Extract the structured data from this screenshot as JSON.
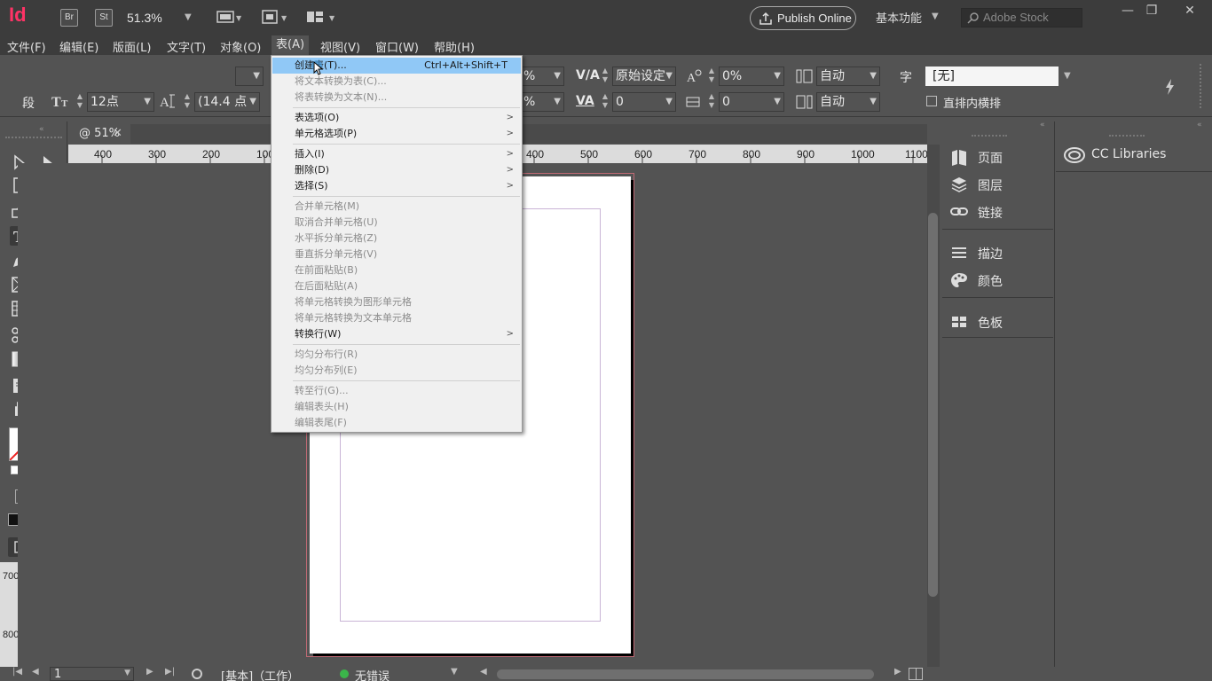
{
  "app": {
    "logo": "Id",
    "badges": [
      "Br",
      "St"
    ],
    "zoom": "51.3%",
    "publish_label": "Publish Online",
    "workspace": "基本功能",
    "stock_placeholder": "Adobe Stock"
  },
  "menubar": {
    "items": [
      "文件(F)",
      "编辑(E)",
      "版面(L)",
      "文字(T)",
      "对象(O)",
      "表(A)",
      "视图(V)",
      "窗口(W)",
      "帮助(H)"
    ],
    "active": "表(A)"
  },
  "control": {
    "paragraph_label": "段",
    "font_size": "12点",
    "leading": "(14.4 点",
    "pct1": "%",
    "pct2": "%",
    "kerning": "原始设定",
    "tracking": "0",
    "baseline_pct": "0%",
    "skew": "0",
    "auto1": "自动",
    "auto2": "自动",
    "char_label": "字",
    "char_style": "[无]",
    "tate_chu_yoko": "直排内横排"
  },
  "document": {
    "tab_label": "@ 51%"
  },
  "ruler": {
    "h_labels": [
      "400",
      "300",
      "200",
      "100",
      "400",
      "500",
      "600",
      "700",
      "800",
      "900",
      "1000",
      "1100"
    ],
    "v_labels": [
      "700",
      "800"
    ]
  },
  "dropdown": {
    "items": [
      {
        "label": "创建表(T)...",
        "shortcut": "Ctrl+Alt+Shift+T",
        "disabled": false,
        "highlight": true
      },
      {
        "label": "将文本转换为表(C)...",
        "disabled": true
      },
      {
        "label": "将表转换为文本(N)...",
        "disabled": true
      },
      {
        "label": "表选项(O)",
        "submenu": true,
        "disabled": false
      },
      {
        "label": "单元格选项(P)",
        "submenu": true,
        "disabled": false
      },
      {
        "label": "插入(I)",
        "submenu": true,
        "disabled": false
      },
      {
        "label": "删除(D)",
        "submenu": true,
        "disabled": false
      },
      {
        "label": "选择(S)",
        "submenu": true,
        "disabled": false
      },
      {
        "label": "合并单元格(M)",
        "disabled": true
      },
      {
        "label": "取消合并单元格(U)",
        "disabled": true
      },
      {
        "label": "水平拆分单元格(Z)",
        "disabled": true
      },
      {
        "label": "垂直拆分单元格(V)",
        "disabled": true
      },
      {
        "label": "在前面粘贴(B)",
        "disabled": true
      },
      {
        "label": "在后面粘贴(A)",
        "disabled": true
      },
      {
        "label": "将单元格转换为图形单元格",
        "disabled": true
      },
      {
        "label": "将单元格转换为文本单元格",
        "disabled": true
      },
      {
        "label": "转换行(W)",
        "submenu": true,
        "disabled": false
      },
      {
        "label": "均匀分布行(R)",
        "disabled": true
      },
      {
        "label": "均匀分布列(E)",
        "disabled": true
      },
      {
        "label": "转至行(G)...",
        "disabled": true
      },
      {
        "label": "编辑表头(H)",
        "disabled": true
      },
      {
        "label": "编辑表尾(F)",
        "disabled": true
      }
    ]
  },
  "panels": {
    "col1": [
      "页面",
      "图层",
      "链接",
      "描边",
      "颜色",
      "色板"
    ],
    "cc_libraries": "CC Libraries"
  },
  "status": {
    "page": "1",
    "master": "[基本]（工作）",
    "preflight": "无错误"
  },
  "colors": {
    "accent": "#ff3366",
    "menu_highlight": "#90c8f6",
    "preflight_ok": "#3bb54a"
  }
}
